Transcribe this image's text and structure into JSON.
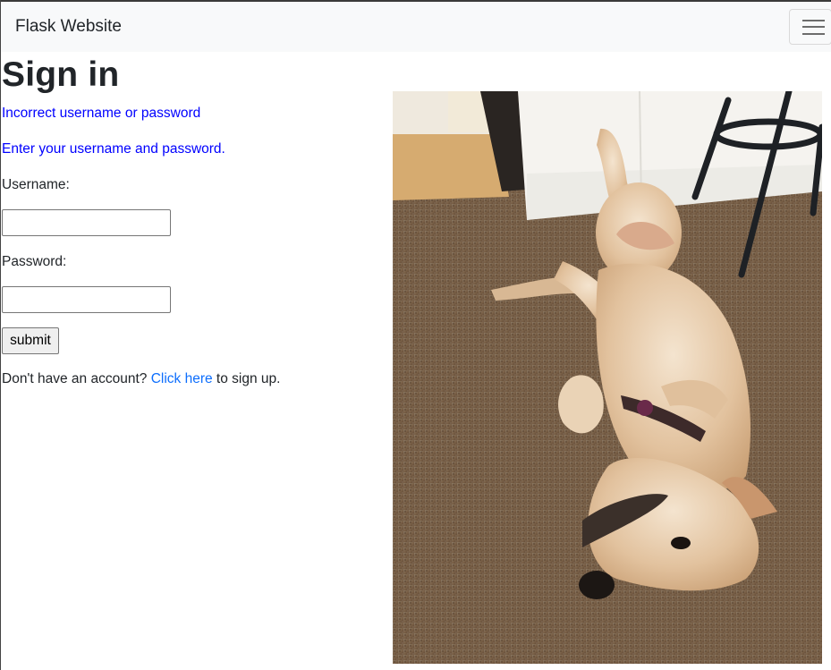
{
  "navbar": {
    "brand": "Flask Website",
    "menu_icon": "hamburger-menu-icon"
  },
  "page": {
    "title": "Sign in",
    "error_message": "Incorrect username or password",
    "instruction": "Enter your username and password.",
    "username_label": "Username:",
    "username_value": "",
    "password_label": "Password:",
    "password_value": "",
    "submit_label": "submit",
    "signup_prefix": "Don't have an account? ",
    "signup_link": "Click here",
    "signup_suffix": " to sign up."
  },
  "image": {
    "subject": "dog lying on its back on a carpet"
  },
  "colors": {
    "navbar_bg": "#f8f9fa",
    "message_text": "#0000ff",
    "link": "#0d6efd"
  }
}
